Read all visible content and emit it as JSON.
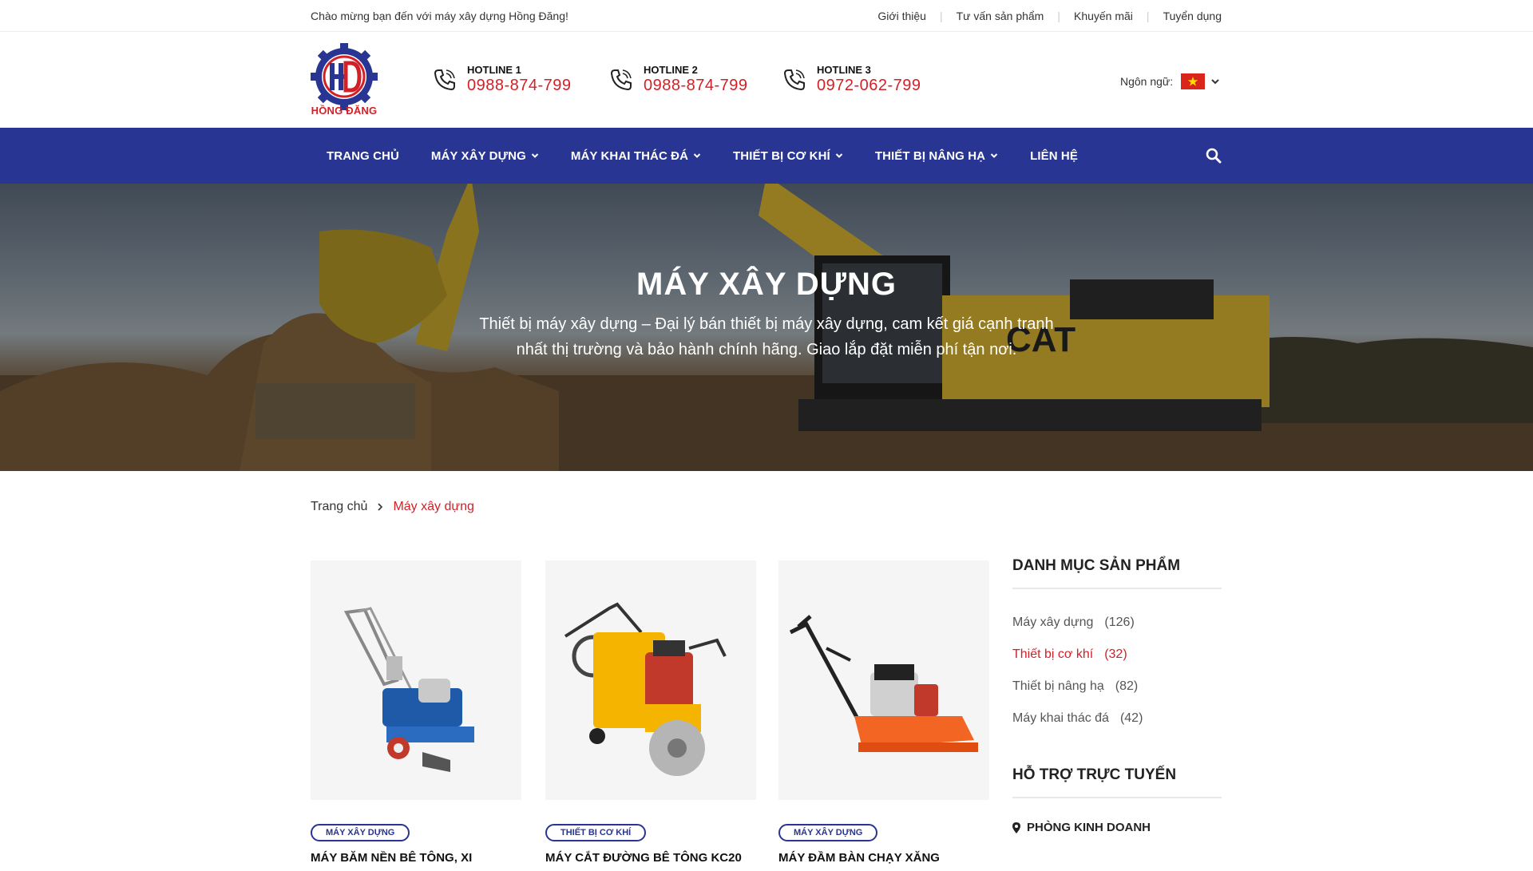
{
  "topbar": {
    "welcome": "Chào mừng bạn đến với máy xây dựng Hồng Đăng!",
    "links": [
      "Giới thiệu",
      "Tư vấn sản phẩm",
      "Khuyến mãi",
      "Tuyển dụng"
    ]
  },
  "header": {
    "logo_text": "HỒNG ĐĂNG",
    "hotlines": [
      {
        "label": "HOTLINE 1",
        "number": "0988-874-799"
      },
      {
        "label": "HOTLINE 2",
        "number": "0988-874-799"
      },
      {
        "label": "HOTLINE 3",
        "number": "0972-062-799"
      }
    ],
    "language_label": "Ngôn ngữ:"
  },
  "nav": {
    "items": [
      {
        "label": "TRANG CHỦ",
        "dropdown": false
      },
      {
        "label": "MÁY XÂY DỰNG",
        "dropdown": true
      },
      {
        "label": "MÁY KHAI THÁC ĐÁ",
        "dropdown": true
      },
      {
        "label": "THIẾT BỊ CƠ KHÍ",
        "dropdown": true
      },
      {
        "label": "THIẾT BỊ NÂNG HẠ",
        "dropdown": true
      },
      {
        "label": "LIÊN HỆ",
        "dropdown": false
      }
    ]
  },
  "banner": {
    "title": "MÁY XÂY DỰNG",
    "description": "Thiết bị máy xây dựng – Đại lý bán thiết bị máy xây dựng, cam kết giá cạnh tranh nhất thị trường và bảo hành chính hãng. Giao lắp đặt miễn phí tận nơi."
  },
  "breadcrumb": {
    "home": "Trang chủ",
    "current": "Máy xây dựng"
  },
  "products": [
    {
      "tag": "MÁY XÂY DỰNG",
      "title": "MÁY BĂM NỀN BÊ TÔNG, XI"
    },
    {
      "tag": "THIẾT BỊ CƠ KHÍ",
      "title": "MÁY CẮT ĐƯỜNG BÊ TÔNG KC20"
    },
    {
      "tag": "MÁY XÂY DỰNG",
      "title": "MÁY ĐẦM BÀN CHẠY XĂNG"
    }
  ],
  "sidebar": {
    "categories_title": "DANH MỤC SẢN PHẨM",
    "categories": [
      {
        "name": "Máy xây dựng",
        "count": "(126)",
        "active": false
      },
      {
        "name": "Thiết bị cơ khí",
        "count": "(32)",
        "active": true
      },
      {
        "name": "Thiết bị nâng hạ",
        "count": "(82)",
        "active": false
      },
      {
        "name": "Máy khai thác đá",
        "count": "(42)",
        "active": false
      }
    ],
    "support_title": "HỖ TRỢ TRỰC TUYẾN",
    "support_item": "PHÒNG KINH DOANH"
  },
  "colors": {
    "brand_blue": "#283593",
    "brand_red": "#d32027"
  },
  "icons": {
    "phone": "phone-icon",
    "search": "search-icon",
    "chevron": "chevron-down-icon",
    "location": "location-pin-icon",
    "flag": "vietnam-flag-icon"
  }
}
